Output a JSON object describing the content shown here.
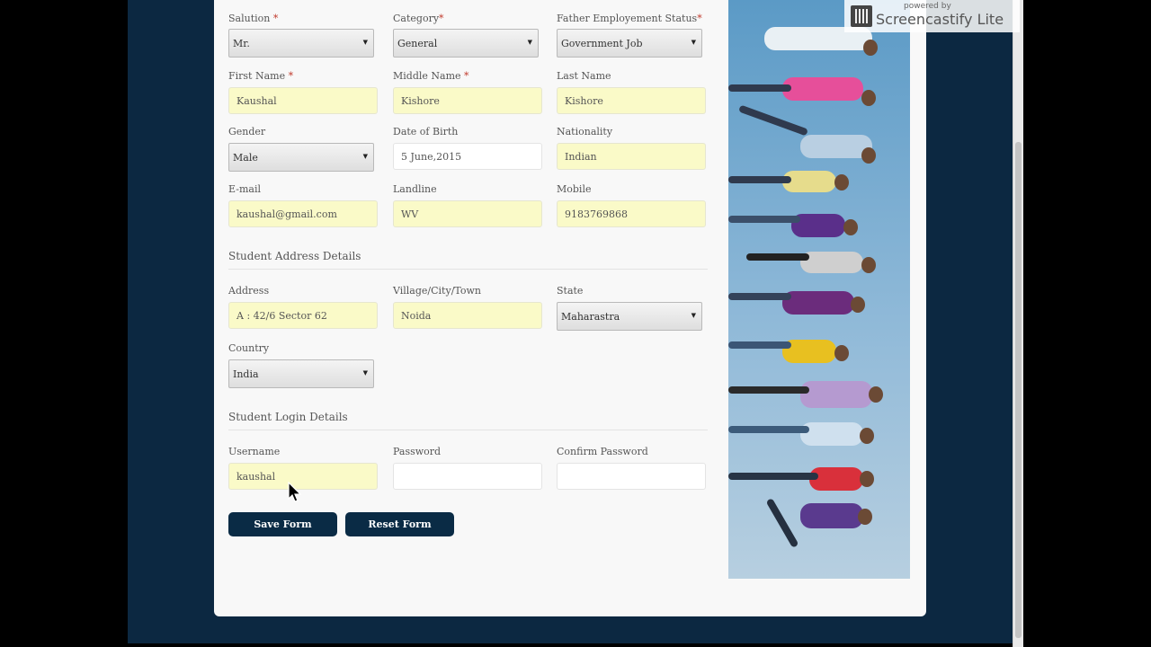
{
  "form": {
    "salutation": {
      "label": "Salution",
      "value": "Mr."
    },
    "category": {
      "label": "Category",
      "value": "General"
    },
    "father_status": {
      "label": "Father Employement Status",
      "value": "Government Job"
    },
    "first_name": {
      "label": "First Name",
      "value": "Kaushal"
    },
    "middle_name": {
      "label": "Middle Name",
      "value": "Kishore"
    },
    "last_name": {
      "label": "Last Name",
      "value": "Kishore"
    },
    "gender": {
      "label": "Gender",
      "value": "Male"
    },
    "dob": {
      "label": "Date of Birth",
      "value": "5 June,2015"
    },
    "nationality": {
      "label": "Nationality",
      "value": "Indian"
    },
    "email": {
      "label": "E-mail",
      "value": "kaushal@gmail.com"
    },
    "landline": {
      "label": "Landline",
      "value": "WV"
    },
    "mobile": {
      "label": "Mobile",
      "value": "9183769868"
    },
    "address_section": "Student Address Details",
    "address": {
      "label": "Address",
      "value": "A : 42/6 Sector 62"
    },
    "village": {
      "label": "Village/City/Town",
      "value": "Noida"
    },
    "state": {
      "label": "State",
      "value": "Maharastra"
    },
    "country": {
      "label": "Country",
      "value": "India"
    },
    "login_section": "Student Login Details",
    "username": {
      "label": "Username",
      "value": "kaushal"
    },
    "password": {
      "label": "Password",
      "value": ""
    },
    "confirm_password": {
      "label": "Confirm Password",
      "value": ""
    },
    "required_mark": "*",
    "save_button": "Save Form",
    "reset_button": "Reset Form"
  },
  "watermark": {
    "small": "powered by",
    "big": "Screencastify Lite"
  },
  "colors": {
    "page_bg": "#0c2841",
    "input_fill": "#fafac8",
    "button": "#0a2b45"
  },
  "icons": {
    "select_arrow": "select-arrow-icon",
    "cursor": "mouse-cursor-icon"
  }
}
